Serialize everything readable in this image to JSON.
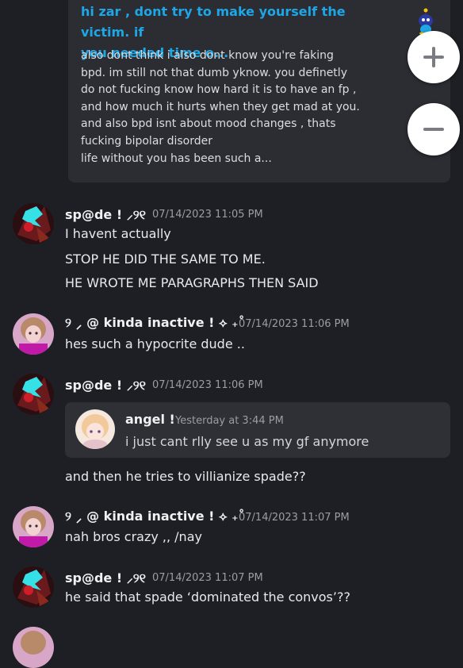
{
  "embed": {
    "title_line1": "hi zar , dont try to make yourself the victim. if",
    "title_line2": "you needed time o...",
    "body_lines": [
      "also dont think i also dont know you're faking",
      "bpd. im still not that dumb yknow. you definetly",
      "do not fucking know how hard it is to have an fp ,",
      "and how much it hurts when they get mad at you.",
      "and also bpd isnt about mood changes , thats",
      "fucking bipolar disorder",
      "life without you has been such a..."
    ]
  },
  "messages": [
    {
      "author": "sp@de ! ⸝୨୧",
      "time": "07/14/2023 11:05 PM",
      "lines": [
        "I havent actually",
        "STOP HE DID THE SAME TO ME.",
        "HE WROTE ME PARAGRAPHS THEN SAID"
      ]
    },
    {
      "author": "୨ ⸝ @ kinda inactive ! ⟡ ₊˚",
      "time": "07/14/2023 11:06 PM",
      "lines": [
        "hes such a hypocrite dude .."
      ]
    },
    {
      "author": "sp@de ! ⸝୨୧",
      "time": "07/14/2023 11:06 PM",
      "reply": {
        "author": "angel !",
        "time": "Yesterday at 3:44 PM",
        "text": "i just cant rlly see u as my gf anymore"
      },
      "lines": [
        "and then he tries to villianize spade??"
      ]
    },
    {
      "author": "୨ ⸝ @ kinda inactive ! ⟡ ₊˚",
      "time": "07/14/2023 11:07 PM",
      "lines": [
        "nah bros crazy ,, /nay"
      ]
    },
    {
      "author": "sp@de ! ⸝୨୧",
      "time": "07/14/2023 11:07 PM",
      "lines": [
        "he said that spade ‘dominated the convos’??"
      ]
    }
  ],
  "colors": {
    "background": "#1e1f24",
    "embed_bg": "#2b2d33",
    "link": "#1ea7e6",
    "timestamp": "#9c9da3"
  },
  "icons": {
    "zoom_in": "plus-icon",
    "zoom_out": "minus-icon"
  }
}
